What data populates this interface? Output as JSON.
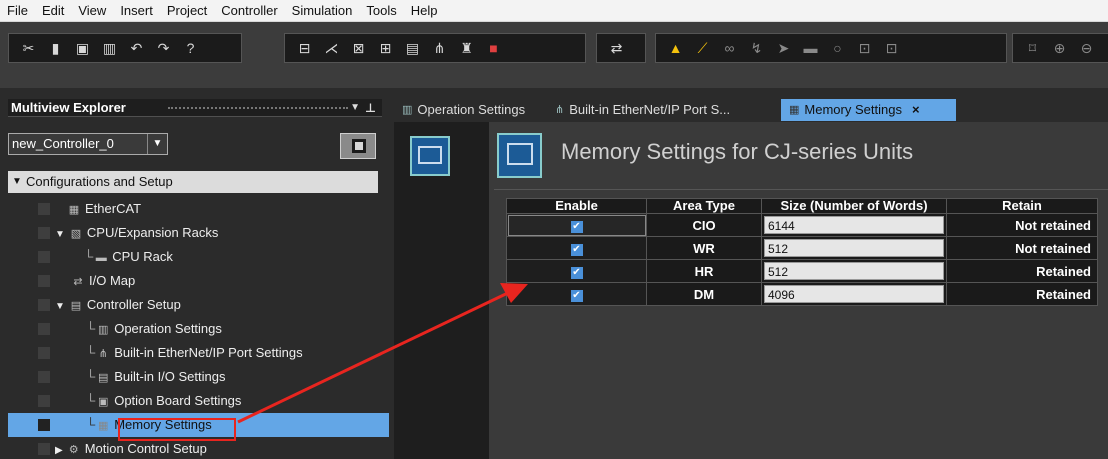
{
  "menu": [
    "File",
    "Edit",
    "View",
    "Insert",
    "Project",
    "Controller",
    "Simulation",
    "Tools",
    "Help"
  ],
  "toolbar": {
    "group1_icons": [
      "cut-icon",
      "copy-icon",
      "paste-icon",
      "delete-icon",
      "undo-icon",
      "redo-icon",
      "help-icon"
    ],
    "group2_icons": [
      "build-icon",
      "tool-icon",
      "cross-ref-icon",
      "compare-icon",
      "table-icon",
      "network-icon",
      "find-icon",
      "stop-icon"
    ],
    "group3_icons": [
      "online-icon"
    ],
    "group4_icons": [
      "warning-icon",
      "clear-warning-icon",
      "link-icon",
      "force-icon",
      "pointer-icon",
      "monitor-icon",
      "circle-icon",
      "node-icon",
      "node2-icon"
    ],
    "group5_icons": [
      "window-icon",
      "zoom-in-icon",
      "zoom-out-icon"
    ]
  },
  "explorer": {
    "title": "Multiview Explorer",
    "controller": "new_Controller_0",
    "tree_root": "Configurations and Setup",
    "items": [
      {
        "label": "EtherCAT",
        "icon": "ethercat-icon",
        "expander": ""
      },
      {
        "label": "CPU/Expansion Racks",
        "icon": "rack-icon",
        "expander": "▼"
      },
      {
        "label": "CPU Rack",
        "icon": "cpu-rack-icon",
        "expander": "└"
      },
      {
        "label": "I/O Map",
        "icon": "io-map-icon",
        "expander": ""
      },
      {
        "label": "Controller Setup",
        "icon": "controller-setup-icon",
        "expander": "▼"
      },
      {
        "label": "Operation Settings",
        "icon": "operation-settings-icon",
        "expander": "└"
      },
      {
        "label": "Built-in EtherNet/IP Port Settings",
        "icon": "ethernet-ip-icon",
        "expander": "└"
      },
      {
        "label": "Built-in I/O Settings",
        "icon": "io-settings-icon",
        "expander": "└"
      },
      {
        "label": "Option Board Settings",
        "icon": "option-board-icon",
        "expander": "└"
      },
      {
        "label": "Memory Settings",
        "icon": "memory-settings-icon",
        "expander": "└"
      },
      {
        "label": "Motion Control Setup",
        "icon": "motion-control-icon",
        "expander": "▶"
      }
    ]
  },
  "tabs": [
    {
      "label": "Operation Settings",
      "icon": "operation-settings-icon",
      "active": false
    },
    {
      "label": "Built-in EtherNet/IP Port S...",
      "icon": "ethernet-ip-icon",
      "active": false
    },
    {
      "label": "Memory Settings",
      "icon": "memory-settings-icon",
      "active": true,
      "close": "×"
    }
  ],
  "page": {
    "title": "Memory Settings for CJ-series Units"
  },
  "memory_table": {
    "headers": [
      "Enable",
      "Area Type",
      "Size (Number of Words)",
      "Retain"
    ],
    "rows": [
      {
        "enable": true,
        "area": "CIO",
        "size": "6144",
        "retain": "Not retained"
      },
      {
        "enable": true,
        "area": "WR",
        "size": "512",
        "retain": "Not retained"
      },
      {
        "enable": true,
        "area": "HR",
        "size": "512",
        "retain": "Retained"
      },
      {
        "enable": true,
        "area": "DM",
        "size": "4096",
        "retain": "Retained"
      }
    ]
  },
  "colors": {
    "selection": "#63a6e6",
    "annotation_red": "#e8251f",
    "checkbox": "#4a90d9"
  }
}
